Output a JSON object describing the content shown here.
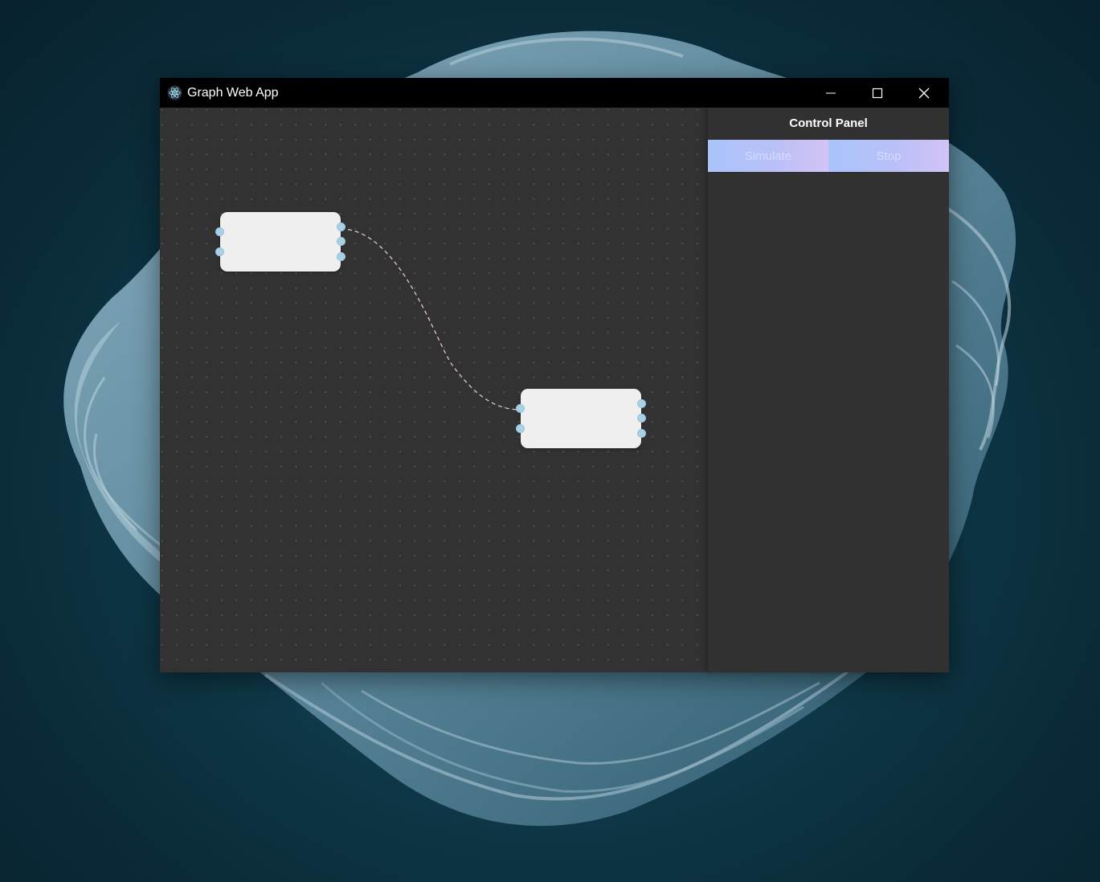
{
  "window": {
    "title": "Graph Web App",
    "controls": {
      "minimize": "minimize-icon",
      "maximize": "maximize-icon",
      "close": "close-icon"
    }
  },
  "canvas": {
    "nodes": [
      {
        "id": "node-1",
        "input_ports": 2,
        "output_ports": 3
      },
      {
        "id": "node-2",
        "input_ports": 2,
        "output_ports": 3
      }
    ],
    "edges": [
      {
        "from": "node-1",
        "to": "node-2",
        "style": "dashed"
      }
    ]
  },
  "control_panel": {
    "title": "Control Panel",
    "simulate_label": "Simulate",
    "stop_label": "Stop"
  },
  "colors": {
    "titlebar": "#000000",
    "canvas_bg": "#323232",
    "panel_bg": "#313131",
    "node_fill": "#efefef",
    "port_fill": "#a8d0e6",
    "edge_stroke": "#e6c4d4",
    "button_gradient_start": "#a9c4fb",
    "button_gradient_end": "#d3c3f6"
  }
}
